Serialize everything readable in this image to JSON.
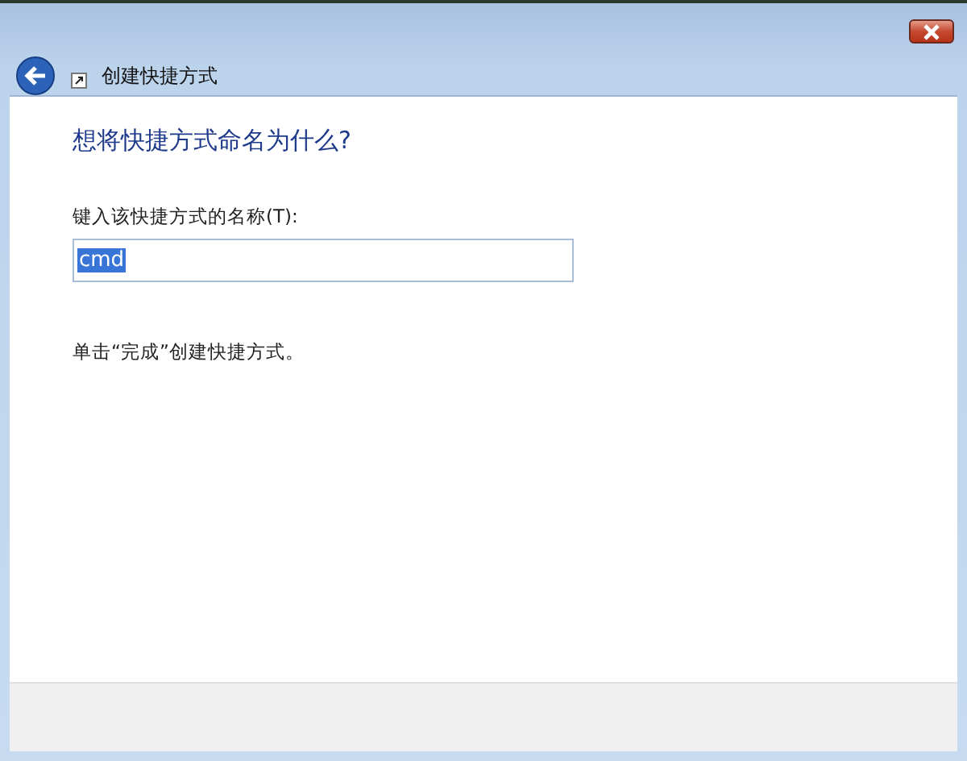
{
  "window": {
    "title": "创建快捷方式"
  },
  "heading": "想将快捷方式命名为什么?",
  "name_field": {
    "label": "键入该快捷方式的名称(T):",
    "value": "cmd",
    "text_selected": true
  },
  "instruction": "单击“完成”创建快捷方式。"
}
